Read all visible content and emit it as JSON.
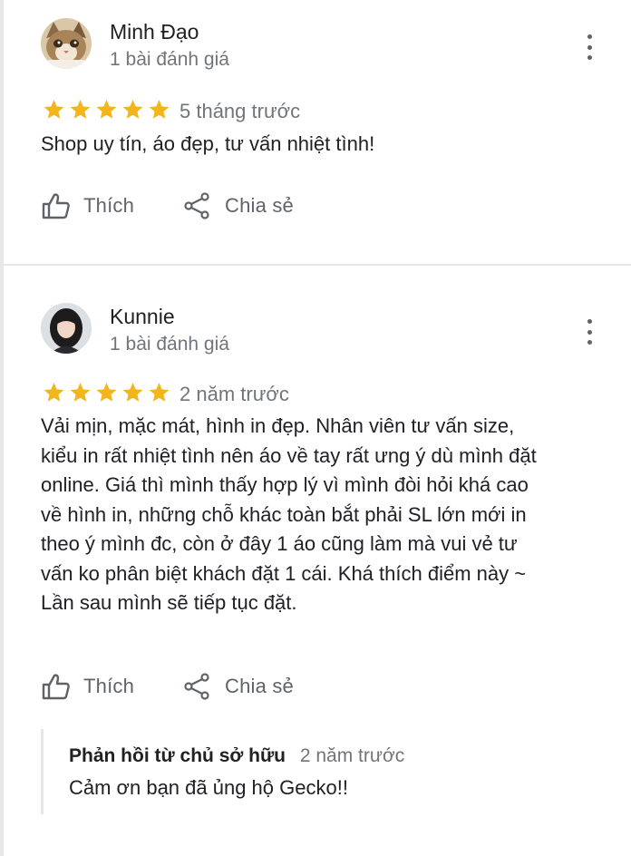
{
  "colors": {
    "star": "#f2b51c",
    "text_primary": "#202124",
    "text_secondary": "#70757a",
    "icon": "#5f6368",
    "divider": "#e6e6e6"
  },
  "reviews": [
    {
      "author": "Minh Đạo",
      "review_count": "1 bài đánh giá",
      "rating": 5,
      "time": "5 tháng trước",
      "text": "Shop uy tín, áo đẹp, tư vấn nhiệt tình!",
      "like_label": "Thích",
      "share_label": "Chia sẻ",
      "avatar_icon": "cat-avatar"
    },
    {
      "author": "Kunnie",
      "review_count": "1 bài đánh giá",
      "rating": 5,
      "time": "2 năm trước",
      "text": "Vải mịn, mặc mát, hình in đẹp. Nhân viên tư vấn size,\nkiểu in rất nhiệt tình nên áo về tay rất ưng ý dù mình đặt\nonline. Giá thì mình thấy hợp lý vì mình đòi hỏi khá cao\nvề hình in, những chỗ khác toàn bắt phải SL lớn mới in\ntheo ý mình đc, còn ở đây 1 áo cũng làm mà vui vẻ tư\nvấn ko phân biệt khách đặt 1 cái. Khá thích điểm này ~\nLần sau mình sẽ tiếp tục đặt.",
      "like_label": "Thích",
      "share_label": "Chia sẻ",
      "avatar_icon": "girl-avatar",
      "owner_reply": {
        "label": "Phản hồi từ chủ sở hữu",
        "time": "2 năm trước",
        "text": "Cảm ơn bạn đã ủng hộ Gecko!!"
      }
    }
  ]
}
